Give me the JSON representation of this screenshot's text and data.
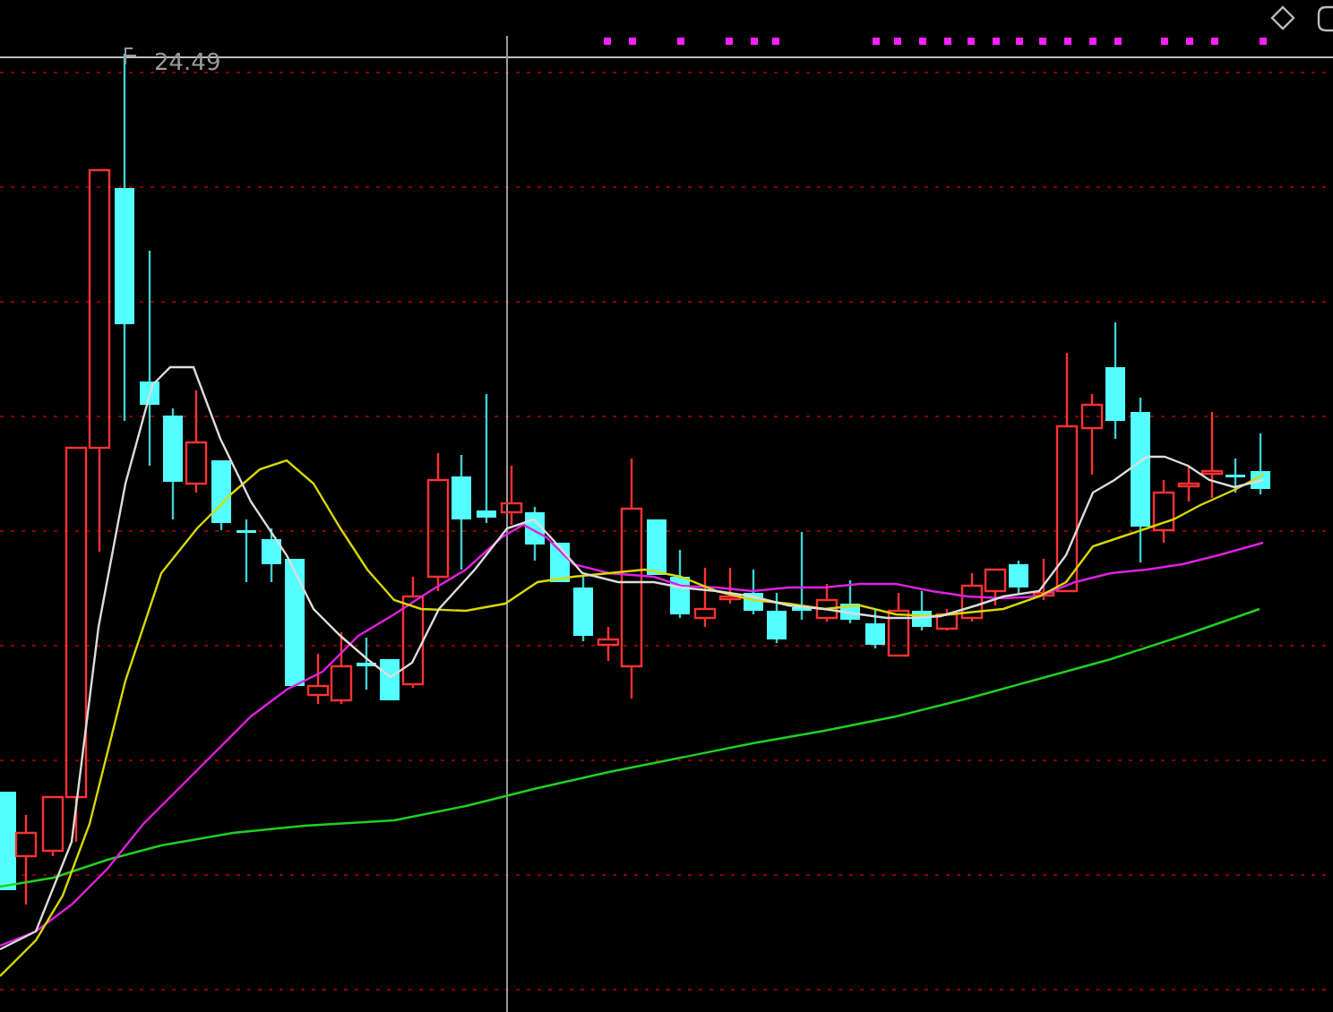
{
  "chart": {
    "high_price_label": "24.49"
  }
}
